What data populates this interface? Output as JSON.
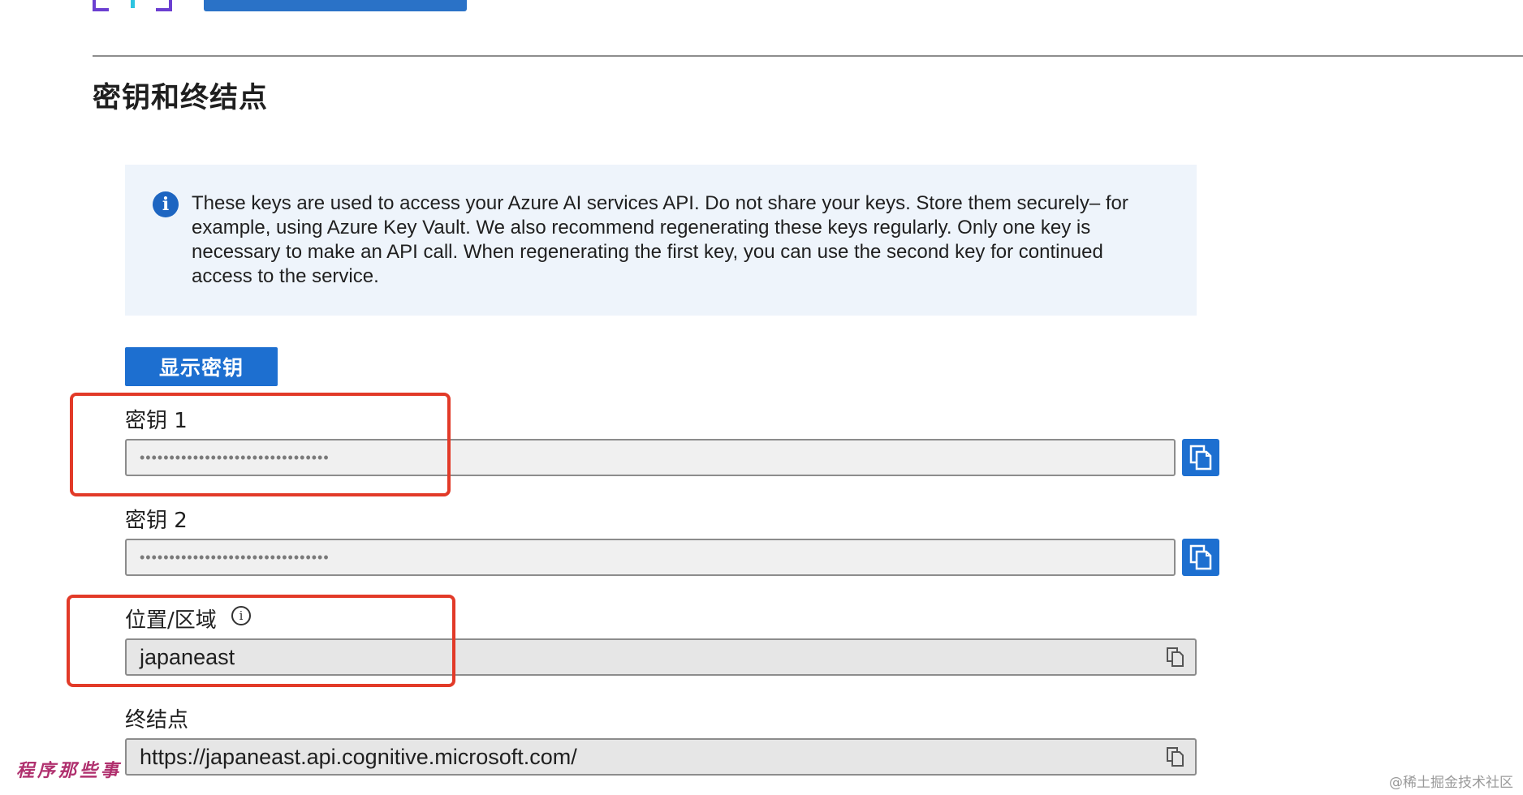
{
  "section": {
    "title": "密钥和终结点"
  },
  "info_banner": {
    "icon": "info-icon",
    "glyph": "i",
    "text": "These keys are used to access your Azure AI services API. Do not share your keys. Store them securely– for example, using Azure Key Vault. We also recommend regenerating these keys regularly. Only one key is necessary to make an API call. When regenerating the first key, you can use the second key for continued access to the service."
  },
  "show_keys_button": {
    "label": "显示密钥"
  },
  "fields": {
    "key1": {
      "label": "密钥 1",
      "value": "••••••••••••••••••••••••••••••••",
      "copy_icon": "copy-icon"
    },
    "key2": {
      "label": "密钥 2",
      "value": "••••••••••••••••••••••••••••••••",
      "copy_icon": "copy-icon"
    },
    "location": {
      "label": "位置/区域",
      "info_glyph": "i",
      "value": "japaneast",
      "copy_icon": "copy-icon"
    },
    "endpoint": {
      "label": "终结点",
      "value": "https://japaneast.api.cognitive.microsoft.com/",
      "copy_icon": "copy-icon"
    }
  },
  "watermarks": {
    "left": "程序那些事",
    "right": "@稀土掘金技术社区"
  },
  "colors": {
    "accent": "#1d6fd0",
    "highlight": "#e23a28",
    "info_bg": "#eef4fb"
  }
}
